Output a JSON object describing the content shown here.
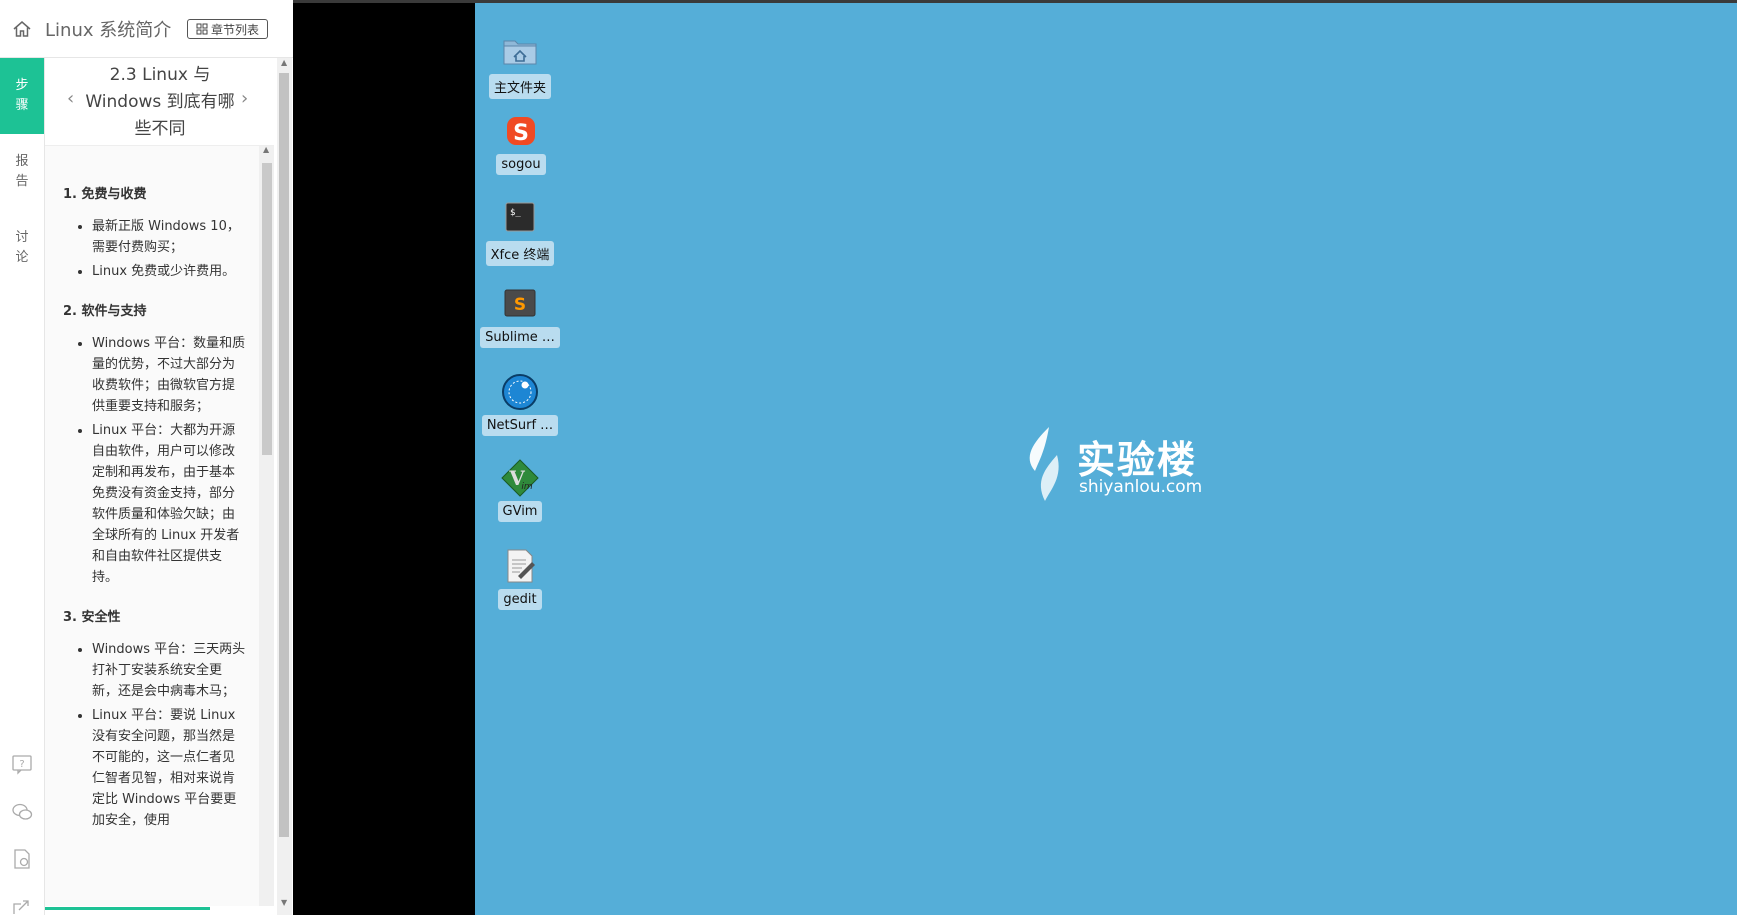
{
  "header": {
    "course_title": "Linux 系统简介",
    "chapter_list_label": "章节列表"
  },
  "side_tabs": [
    {
      "label": "步骤",
      "active": true
    },
    {
      "label": "报告",
      "active": false
    },
    {
      "label": "讨论",
      "active": false
    }
  ],
  "side_icons": [
    "question-icon",
    "wechat-icon",
    "document-settings-icon",
    "share-icon"
  ],
  "step": {
    "title": "2.3 Linux 与 Windows 到底有哪些不同",
    "prev": "‹",
    "next": "›"
  },
  "content": {
    "sections": [
      {
        "heading": "1. 免费与收费",
        "items": [
          "最新正版 Windows 10，需要付费购买；",
          "Linux 免费或少许费用。"
        ]
      },
      {
        "heading": "2. 软件与支持",
        "items": [
          "Windows 平台：数量和质量的优势，不过大部分为收费软件；由微软官方提供重要支持和服务；",
          "Linux 平台：大都为开源自由软件，用户可以修改定制和再发布，由于基本免费没有资金支持，部分软件质量和体验欠缺；由全球所有的 Linux 开发者和自由软件社区提供支持。"
        ]
      },
      {
        "heading": "3. 安全性",
        "items": [
          "Windows 平台：三天两头打补丁安装系统安全更新，还是会中病毒木马；",
          "Linux 平台：要说 Linux 没有安全问题，那当然是不可能的，这一点仁者见仁智者见智，相对来说肯定比 Windows 平台要更加安全，使用"
        ]
      }
    ]
  },
  "desktop": {
    "icons": [
      {
        "label": "主文件夹",
        "icon": "home-folder-icon"
      },
      {
        "label": "sogou",
        "icon": "sogou-icon"
      },
      {
        "label": "Xfce 终端",
        "icon": "terminal-icon"
      },
      {
        "label": "Sublime …",
        "icon": "sublime-icon"
      },
      {
        "label": "NetSurf …",
        "icon": "netsurf-icon"
      },
      {
        "label": "GVim",
        "icon": "gvim-icon"
      },
      {
        "label": "gedit",
        "icon": "gedit-icon"
      }
    ],
    "logo_cn": "实验楼",
    "logo_en": "shiyanlou.com",
    "background_color": "#55aed8"
  },
  "colors": {
    "accent": "#1dc295"
  }
}
